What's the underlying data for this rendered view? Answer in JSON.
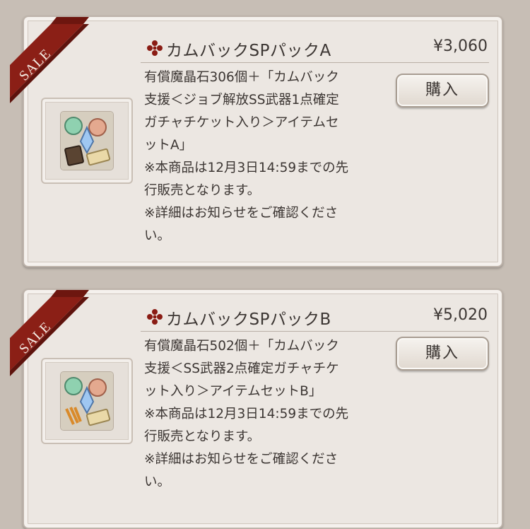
{
  "products": [
    {
      "badge": "SALE",
      "title": "カムバックSPパックA",
      "price": "¥3,060",
      "buy_label": "購入",
      "description_lines": [
        "有償魔晶石306個＋「カムバック",
        "支援＜ジョブ解放SS武器1点確定",
        "ガチャチケット入り＞アイテムセ",
        "ットA」",
        "※本商品は12月3日14:59までの先",
        "行販売となります。",
        "※詳細はお知らせをご確認くださ",
        "い。"
      ]
    },
    {
      "badge": "SALE",
      "title": "カムバックSPパックB",
      "price": "¥5,020",
      "buy_label": "購入",
      "description_lines": [
        "有償魔晶石502個＋「カムバック",
        "支援＜SS武器2点確定ガチャチケ",
        "ット入り＞アイテムセットB」",
        "※本商品は12月3日14:59までの先",
        "行販売となります。",
        "※詳細はお知らせをご確認くださ",
        "い。"
      ]
    }
  ],
  "colors": {
    "ribbon": "#8b1f16",
    "accent_icon": "#8a1c14",
    "text": "#3c3633",
    "background": "#c7beb5",
    "card": "#ece7e2"
  },
  "icons": {
    "title": "fleur-cross-icon",
    "thumbnail": "item-bundle-icon"
  }
}
